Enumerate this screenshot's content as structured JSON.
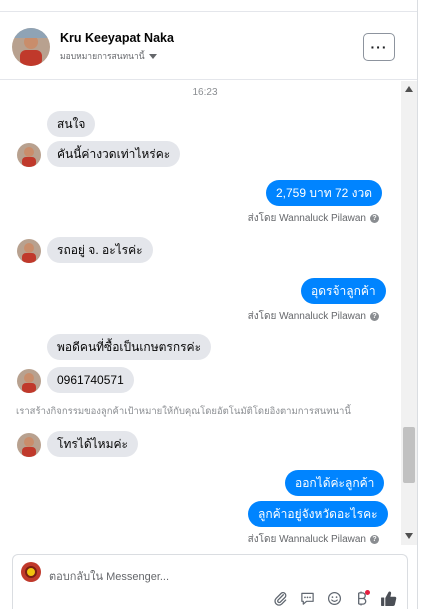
{
  "header": {
    "name": "Kru Keeyapat Naka",
    "subtitle": "มอบหมายการสนทนานี้",
    "more_label": "···"
  },
  "chat": {
    "timestamp": "16:23",
    "messages": [
      {
        "dir": "in",
        "text": "สนใจ"
      },
      {
        "dir": "in",
        "text": "คันนี้ค่างวดเท่าไหร่คะ"
      },
      {
        "dir": "out",
        "text": "2,759 บาท  72 งวด"
      },
      {
        "dir": "sent_by",
        "text": "ส่งโดย Wannaluck Pilawan"
      },
      {
        "dir": "in",
        "text": "รถอยู่ จ. อะไรค่ะ"
      },
      {
        "dir": "out",
        "text": "อุดรจ้าลูกค้า"
      },
      {
        "dir": "sent_by",
        "text": "ส่งโดย Wannaluck Pilawan"
      },
      {
        "dir": "in",
        "text": "พอดีคนที่ซื้อเป็นเกษตรกรค่ะ"
      },
      {
        "dir": "in",
        "text": "0961740571"
      },
      {
        "dir": "in",
        "text": "โทรได้ไหมค่ะ"
      },
      {
        "dir": "out",
        "text": "ออกได้ค่ะลูกค้า"
      },
      {
        "dir": "out",
        "text": "ลูกค้าอยู่จังหวัดอะไรคะ"
      },
      {
        "dir": "sent_by",
        "text": "ส่งโดย Wannaluck Pilawan"
      }
    ],
    "system_note": "เราสร้างกิจกรรมของลูกค้าเป้าหมายให้กับคุณโดยอัตโนมัติโดยอิงตามการสนทนานี้"
  },
  "composer": {
    "placeholder": "ตอบกลับใน Messenger...",
    "icons": [
      "attachment-icon",
      "saved-reply-icon",
      "emoji-icon",
      "payment-icon",
      "like-icon"
    ]
  },
  "colors": {
    "outgoing_bubble": "#0084ff",
    "incoming_bubble": "#e4e6eb",
    "notification_dot": "#e41e3f"
  }
}
